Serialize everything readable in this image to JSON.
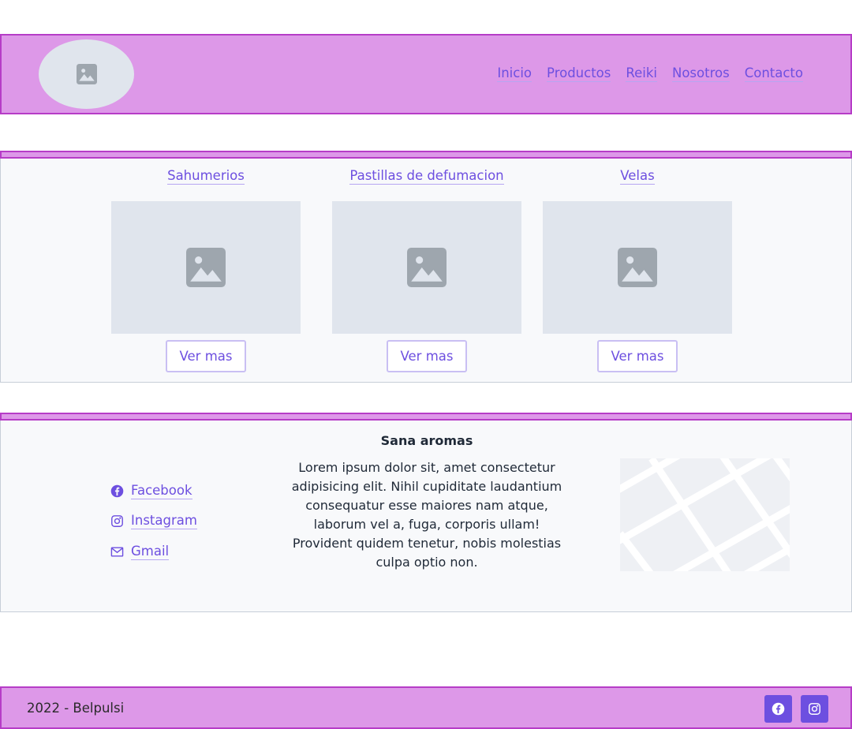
{
  "nav": {
    "items": [
      {
        "label": "Inicio"
      },
      {
        "label": "Productos"
      },
      {
        "label": "Reiki"
      },
      {
        "label": "Nosotros"
      },
      {
        "label": "Contacto"
      }
    ]
  },
  "logo": {
    "icon": "image-placeholder-icon"
  },
  "products": [
    {
      "title": "Sahumerios",
      "button": "Ver mas",
      "icon": "image-placeholder-icon"
    },
    {
      "title": "Pastillas de defumacion",
      "button": "Ver mas",
      "icon": "image-placeholder-icon"
    },
    {
      "title": "Velas",
      "button": "Ver mas",
      "icon": "image-placeholder-icon"
    }
  ],
  "info": {
    "social": [
      {
        "label": "Facebook",
        "icon": "facebook-icon"
      },
      {
        "label": "Instagram",
        "icon": "instagram-icon"
      },
      {
        "label": "Gmail",
        "icon": "mail-icon"
      }
    ],
    "title": "Sana aromas",
    "text": "Lorem ipsum dolor sit, amet consectetur adipisicing elit. Nihil cupiditate laudantium consequatur esse maiores nam atque, laborum vel a, fuga, corporis ullam! Provident quidem tenetur, nobis molestias culpa optio non."
  },
  "footer": {
    "copyright": "2022 - Belpulsi",
    "icons": [
      "facebook-icon",
      "instagram-icon"
    ]
  },
  "colors": {
    "header_bg": "#dd98e8",
    "header_border": "#b63cc7",
    "accent": "#6d4fe0",
    "placeholder_bg": "#e0e5ed",
    "section_bg": "#f8f9fb"
  }
}
